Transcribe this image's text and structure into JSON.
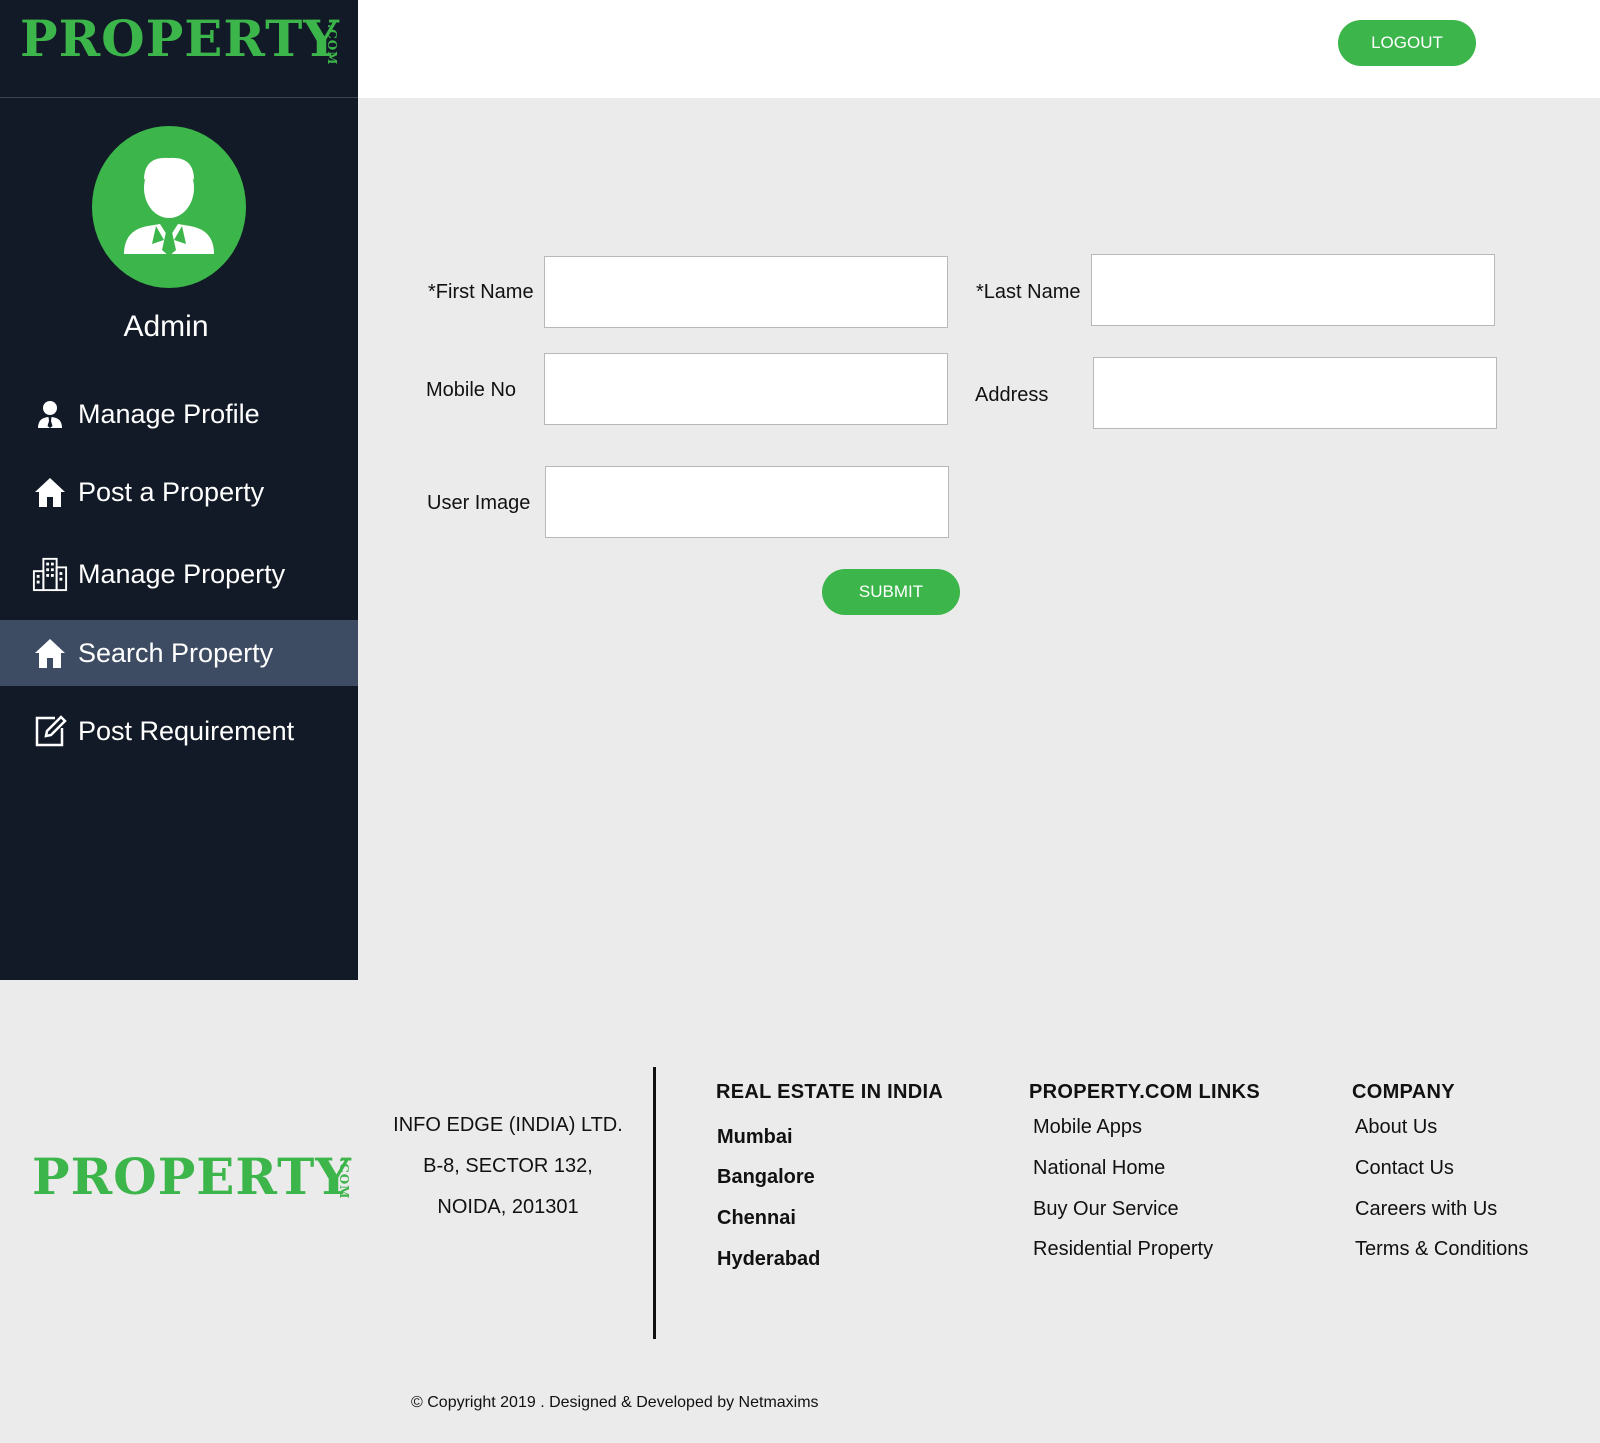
{
  "header": {
    "logo_text": "PROPERTY",
    "logo_suffix": ".COM",
    "logout_label": "LOGOUT"
  },
  "sidebar": {
    "user_name": "Admin",
    "items": [
      {
        "label": "Manage Profile",
        "icon": "user-icon"
      },
      {
        "label": "Post a Property",
        "icon": "home-icon"
      },
      {
        "label": "Manage Property",
        "icon": "buildings-icon"
      },
      {
        "label": "Search Property",
        "icon": "home-icon",
        "active": true
      },
      {
        "label": "Post Requirement",
        "icon": "edit-icon"
      }
    ]
  },
  "form": {
    "first_name_label": "*First Name",
    "last_name_label": "*Last Name",
    "mobile_label": "Mobile No",
    "address_label": "Address",
    "user_image_label": "User Image",
    "first_name_value": "",
    "last_name_value": "",
    "mobile_value": "",
    "address_value": "",
    "user_image_value": "",
    "submit_label": "SUBMIT"
  },
  "footer": {
    "logo_text": "PROPERTY",
    "logo_suffix": ".COM",
    "address": [
      "INFO EDGE (INDIA) LTD.",
      "B-8, SECTOR 132,",
      "NOIDA, 201301"
    ],
    "columns": [
      {
        "heading": "REAL ESTATE IN INDIA",
        "links": [
          "Mumbai",
          "Bangalore",
          "Chennai",
          "Hyderabad"
        ]
      },
      {
        "heading": "PROPERTY.COM LINKS",
        "links": [
          "Mobile Apps",
          "National Home",
          "Buy Our Service",
          "Residential Property"
        ]
      },
      {
        "heading": "COMPANY",
        "links": [
          "About Us",
          "Contact Us",
          "Careers with Us",
          "Terms & Conditions"
        ]
      }
    ],
    "copyright": "© Copyright 2019  . Designed & Developed by Netmaxims"
  },
  "colors": {
    "brand_green": "#3cb54a",
    "sidebar_bg": "#121a27",
    "sidebar_active": "#3e4c63",
    "page_bg": "#ebebeb"
  }
}
